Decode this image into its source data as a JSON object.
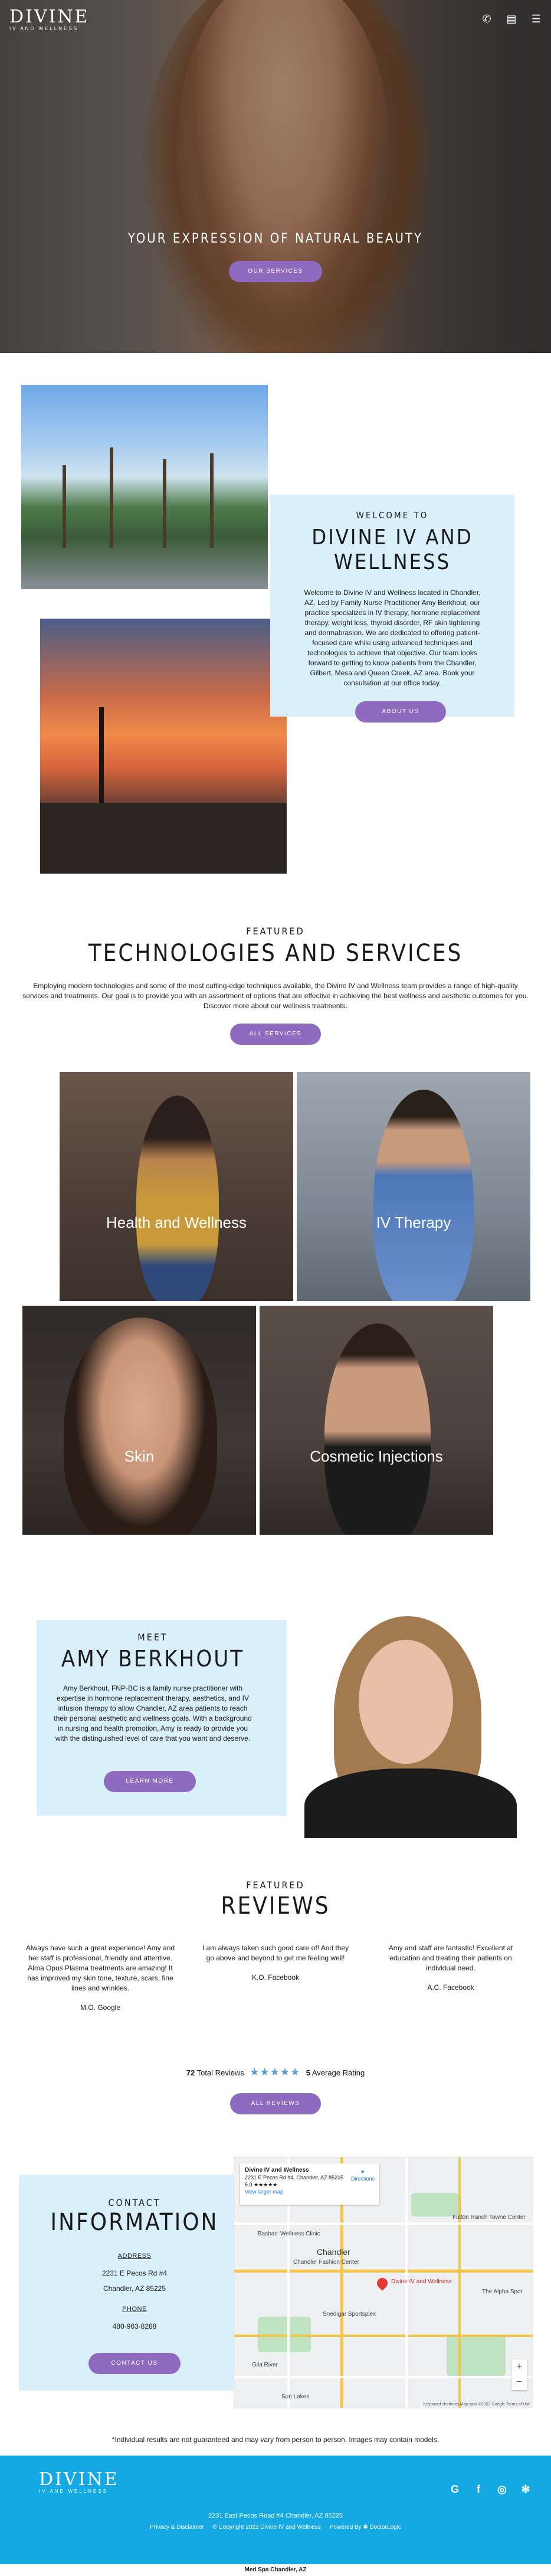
{
  "brand": {
    "logo_main": "DIVINE",
    "logo_sub": "IV AND WELLNESS"
  },
  "header": {
    "icons": [
      "phone-icon",
      "calendar-icon",
      "menu-icon"
    ]
  },
  "hero": {
    "title": "YOUR EXPRESSION OF NATURAL BEAUTY",
    "button": "OUR SERVICES"
  },
  "welcome": {
    "subtitle": "WELCOME TO",
    "title_line1": "DIVINE IV AND",
    "title_line2": "WELLNESS",
    "body": "Welcome to Divine IV and Wellness located in Chandler, AZ. Led by Family Nurse Practitioner Amy Berkhout, our practice specializes in IV therapy, hormone replacement therapy, weight loss, thyroid disorder, RF skin tightening and dermabrasion. We are dedicated to offering patient-focused care while using advanced techniques and technologies to achieve that objective. Our team looks forward to getting to know patients from the Chandler, Gilbert, Mesa and Queen Creek, AZ area. Book your consultation at our office today.",
    "button": "ABOUT US"
  },
  "services": {
    "subtitle": "FEATURED",
    "title": "TECHNOLOGIES AND SERVICES",
    "body": "Employing modern technologies and some of the most cutting-edge techniques available, the Divine IV and Wellness team provides a range of high-quality services and treatments. Our goal is to provide you with an assortment of options that are effective in achieving the best wellness and aesthetic outcomes for you. Discover more about our wellness treatments.",
    "button": "ALL SERVICES",
    "tiles": [
      {
        "label": "Health and Wellness"
      },
      {
        "label": "IV Therapy"
      },
      {
        "label": "Skin"
      },
      {
        "label": "Cosmetic Injections"
      }
    ]
  },
  "meet": {
    "subtitle": "MEET",
    "title": "AMY BERKHOUT",
    "body": "Amy Berkhout, FNP-BC is a family nurse practitioner with expertise in hormone replacement therapy, aesthetics, and IV infusion therapy to allow Chandler, AZ area patients to reach their personal aesthetic and wellness goals. With a background in nursing and health promotion, Amy is ready to provide you with the distinguished level of care that you want and deserve.",
    "button": "LEARN MORE"
  },
  "reviews": {
    "subtitle": "FEATURED",
    "title": "REVIEWS",
    "items": [
      {
        "text": "Always have such a great experience! Amy and her staff is professional, friendly and attentive. Alma Opus Plasma treatments are amazing! It has improved my skin tone, texture, scars, fine lines and wrinkles.",
        "author": "M.O. Google"
      },
      {
        "text": "I am always taken such good care of! And they go above and beyond to get me feeling well!",
        "author": "K.O. Facebook"
      },
      {
        "text": "Amy and staff are fantastic! Excellent at education and treating their patients on individual need.",
        "author": "A.C. Facebook"
      }
    ],
    "total": "72",
    "total_label": "Total Reviews",
    "stars": "★★★★★",
    "average": "5",
    "average_label": "Average Rating",
    "rating_value": 5,
    "button": "ALL REVIEWS"
  },
  "contact": {
    "subtitle": "CONTACT",
    "title": "INFORMATION",
    "address_label": "ADDRESS",
    "address_line1": "2231 E Pecos Rd #4",
    "address_line2": "Chandler, AZ 85225",
    "phone_label": "PHONE",
    "phone": "480-903-8288",
    "button": "CONTACT US"
  },
  "map": {
    "card_name": "Divine IV and Wellness",
    "card_address": "2231 E Pecos Rd #4, Chandler, AZ 85225",
    "card_rating": "5.0 ★★★★★",
    "card_link": "View larger map",
    "directions": "Directions",
    "city": "Chandler",
    "pin_label": "Divine IV and Wellness",
    "places": [
      "Fulton Ranch Towne Center",
      "Bashas' Wellness Clinic",
      "Chandler Fashion Center",
      "Snedigar Sportsplex",
      "The Alpha Spot",
      "Gila River",
      "Sun Lakes"
    ],
    "attribution": "Keyboard shortcuts  Map data ©2023 Google  Terms of Use"
  },
  "disclaimer": "*Individual results are not guaranteed and may vary from person to person. Images may contain models.",
  "footer": {
    "address": "2231 East Pecos Road  #4  Chandler, AZ 85225",
    "links": [
      "Privacy & Disclaimer",
      "© Copyright 2023 Divine IV and Wellness",
      "Powered By  ✱ DoctorLogic"
    ],
    "social": [
      "G",
      "f",
      "◎",
      "✻"
    ]
  },
  "bottom_note": "Med Spa Chandler, AZ",
  "colors": {
    "accent": "#8e6bbf",
    "light_blue": "#d9f0fb",
    "footer_blue": "#15a9e3"
  }
}
